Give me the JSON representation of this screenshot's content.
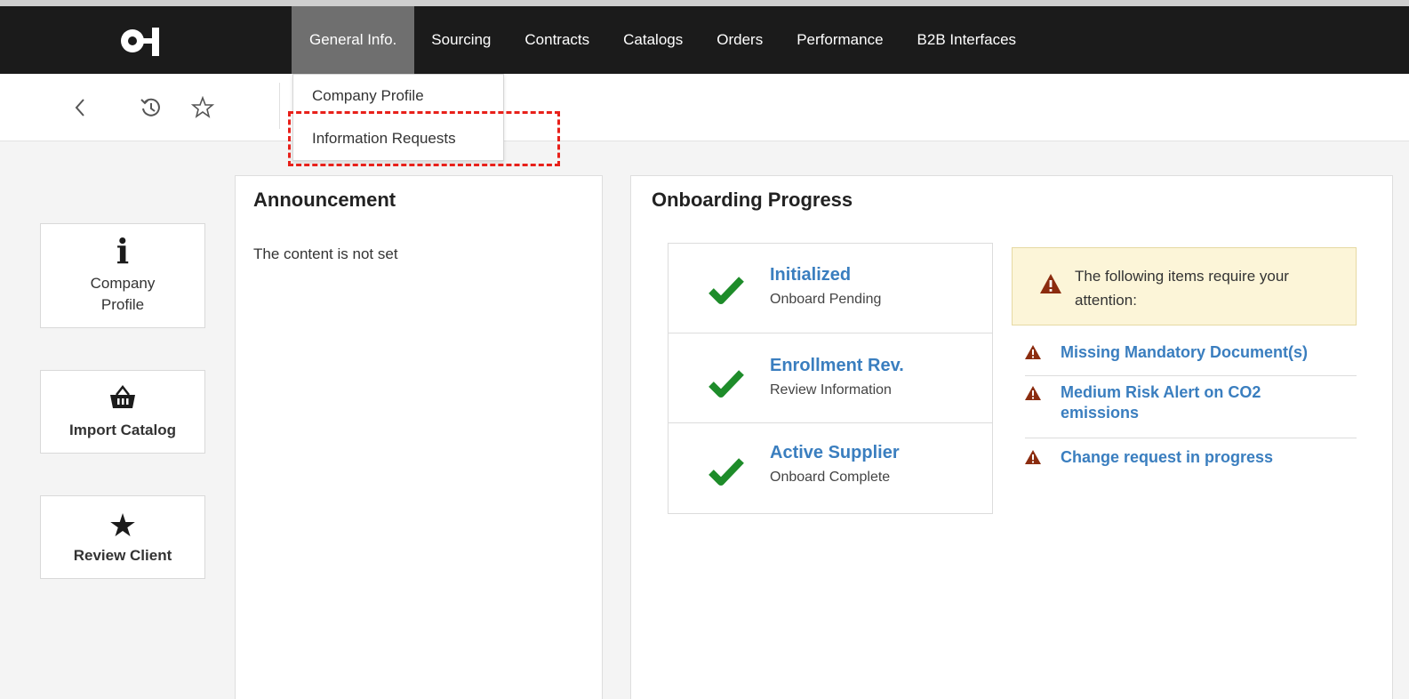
{
  "nav": {
    "logo_text": "O-I",
    "items": [
      {
        "label": "General Info."
      },
      {
        "label": "Sourcing"
      },
      {
        "label": "Contracts"
      },
      {
        "label": "Catalogs"
      },
      {
        "label": "Orders"
      },
      {
        "label": "Performance"
      },
      {
        "label": "B2B Interfaces"
      }
    ],
    "active_index": 0
  },
  "toolbar": {
    "icons": [
      "back-icon",
      "history-icon",
      "star-outline-icon"
    ]
  },
  "dropdown": {
    "items": [
      {
        "label": "Company Profile"
      },
      {
        "label": "Information Requests"
      }
    ],
    "highlighted_index": 1
  },
  "tiles": [
    {
      "icon": "info-icon",
      "glyph": "i",
      "label": "Company Profile"
    },
    {
      "icon": "basket-icon",
      "label": "Import Catalog"
    },
    {
      "icon": "star-icon",
      "glyph": "★",
      "label": "Review Client"
    }
  ],
  "announcement": {
    "title": "Announcement",
    "text": "The content is not set"
  },
  "onboarding": {
    "title": "Onboarding Progress",
    "steps": [
      {
        "title": "Initialized",
        "subtitle": "Onboard Pending"
      },
      {
        "title": "Enrollment Rev.",
        "subtitle": "Review Information"
      },
      {
        "title": "Active Supplier",
        "subtitle": "Onboard Complete"
      }
    ],
    "attention_text": "The following items require your attention:",
    "alerts": [
      {
        "label": "Missing Mandatory Document(s)"
      },
      {
        "label": "Medium Risk Alert on CO2 emissions"
      },
      {
        "label": "Change request in progress"
      }
    ]
  },
  "colors": {
    "nav_bg": "#1b1b1b",
    "nav_active": "#6f6f6f",
    "link": "#3a7ebf",
    "check": "#1e8c2a",
    "warning": "#8b2c0f",
    "attention_bg": "#fcf5d8",
    "highlight": "#e8201a"
  }
}
